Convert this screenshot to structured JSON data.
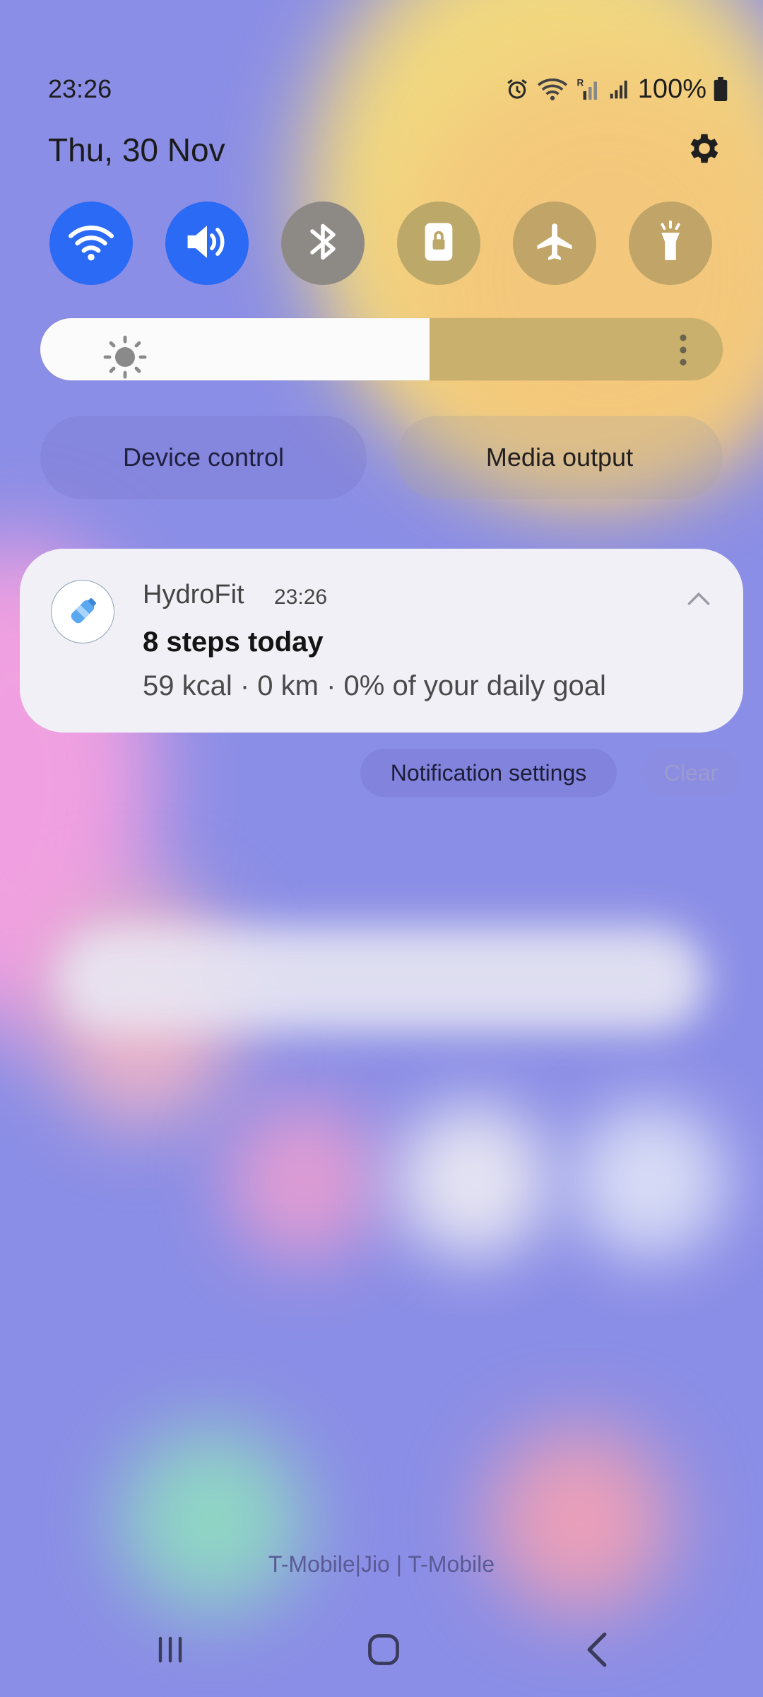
{
  "status_bar": {
    "time": "23:26",
    "battery_percent": "100%",
    "icons": [
      "alarm-icon",
      "wifi-icon",
      "roaming-signal-icon",
      "signal-icon",
      "battery-icon"
    ]
  },
  "header": {
    "date": "Thu, 30 Nov",
    "settings_icon": "gear-icon"
  },
  "quick_tiles": [
    {
      "name": "wifi",
      "icon": "wifi-icon",
      "state": "on"
    },
    {
      "name": "sound",
      "icon": "volume-icon",
      "state": "on"
    },
    {
      "name": "bluetooth",
      "icon": "bluetooth-icon",
      "state": "off"
    },
    {
      "name": "portrait-lock",
      "icon": "lock-icon",
      "state": "off"
    },
    {
      "name": "airplane-mode",
      "icon": "airplane-icon",
      "state": "off"
    },
    {
      "name": "flashlight",
      "icon": "flashlight-icon",
      "state": "off"
    }
  ],
  "brightness": {
    "level": 0.57,
    "icon": "brightness-icon",
    "more_icon": "more-vertical-icon"
  },
  "shortcuts": {
    "device_control": "Device control",
    "media_output": "Media output"
  },
  "notification": {
    "app_name": "HydroFit",
    "time": "23:26",
    "title": "8 steps today",
    "body": "59 kcal · 0 km · 0% of your daily goal",
    "app_icon": "water-bottle-icon"
  },
  "notification_actions": {
    "settings": "Notification settings",
    "clear": "Clear"
  },
  "carrier": "T-Mobile|Jio | T-Mobile",
  "colors": {
    "accent": "#2a6af4",
    "background": "#8b8ee6",
    "tile_off": "#c1a467"
  }
}
